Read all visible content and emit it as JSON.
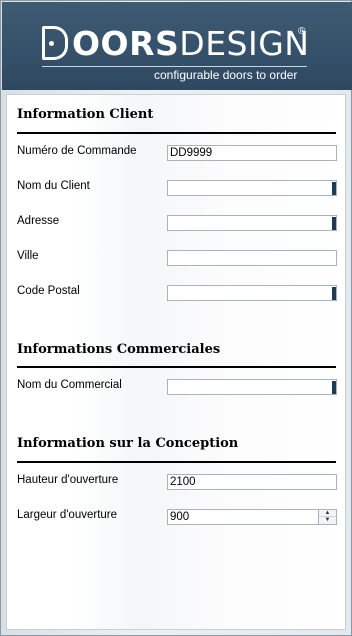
{
  "brand": {
    "logo_name_bold": "OORS",
    "logo_name_light": "DESIGN",
    "logo_registered": "®",
    "tagline": "configurable doors to order"
  },
  "client": {
    "title": "Information Client",
    "order_number": {
      "label": "Numéro de Commande",
      "value": "DD9999"
    },
    "client_name": {
      "label": "Nom du Client",
      "value": ""
    },
    "address": {
      "label": "Adresse",
      "value": ""
    },
    "city": {
      "label": "Ville",
      "value": ""
    },
    "postal_code": {
      "label": "Code Postal",
      "value": ""
    }
  },
  "commercial": {
    "title": "Informations Commerciales",
    "sales_rep": {
      "label": "Nom du Commercial",
      "value": ""
    }
  },
  "design": {
    "title": "Information sur la Conception",
    "opening_height": {
      "label": "Hauteur d'ouverture",
      "value": "2100"
    },
    "opening_width": {
      "label": "Largeur d'ouverture",
      "value": "900"
    }
  },
  "colors": {
    "header_bg": "#35506a",
    "required_marker": "#1f3a55"
  }
}
